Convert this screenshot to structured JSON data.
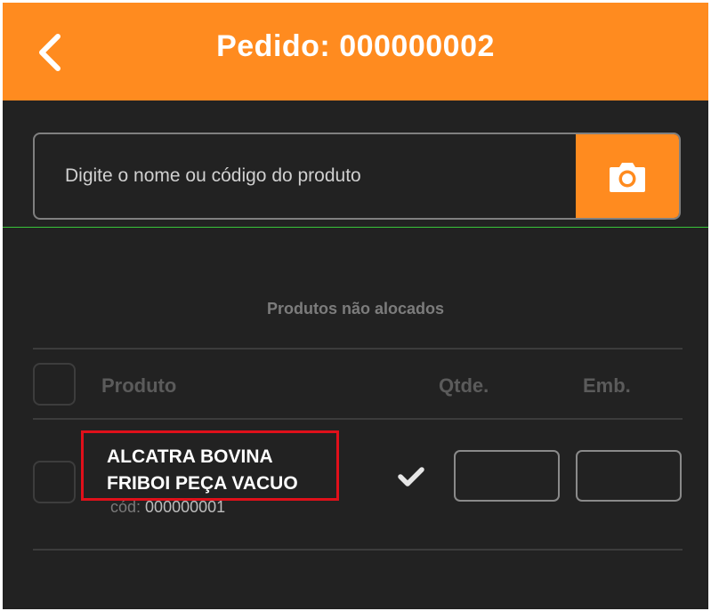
{
  "header": {
    "title": "Pedido: 000000002",
    "back_icon": "chevron-left-icon",
    "background": "#ff8b1f"
  },
  "search": {
    "placeholder": "Digite o nome ou código do produto",
    "value": "",
    "camera_icon": "camera-icon"
  },
  "section": {
    "title": "Produtos não alocados"
  },
  "table": {
    "columns": {
      "produto": "Produto",
      "qtde": "Qtde.",
      "emb": "Emb."
    },
    "rows": [
      {
        "name_line1": "ALCATRA BOVINA",
        "name_line2": "FRIBOI PEÇA VACUO",
        "code_label": "cód:",
        "code": "000000001",
        "qtde": "",
        "emb": "",
        "check_icon": "checkmark-icon"
      }
    ]
  },
  "colors": {
    "accent": "#ff8b1f",
    "background": "#222222",
    "highlight": "#e0101a"
  }
}
